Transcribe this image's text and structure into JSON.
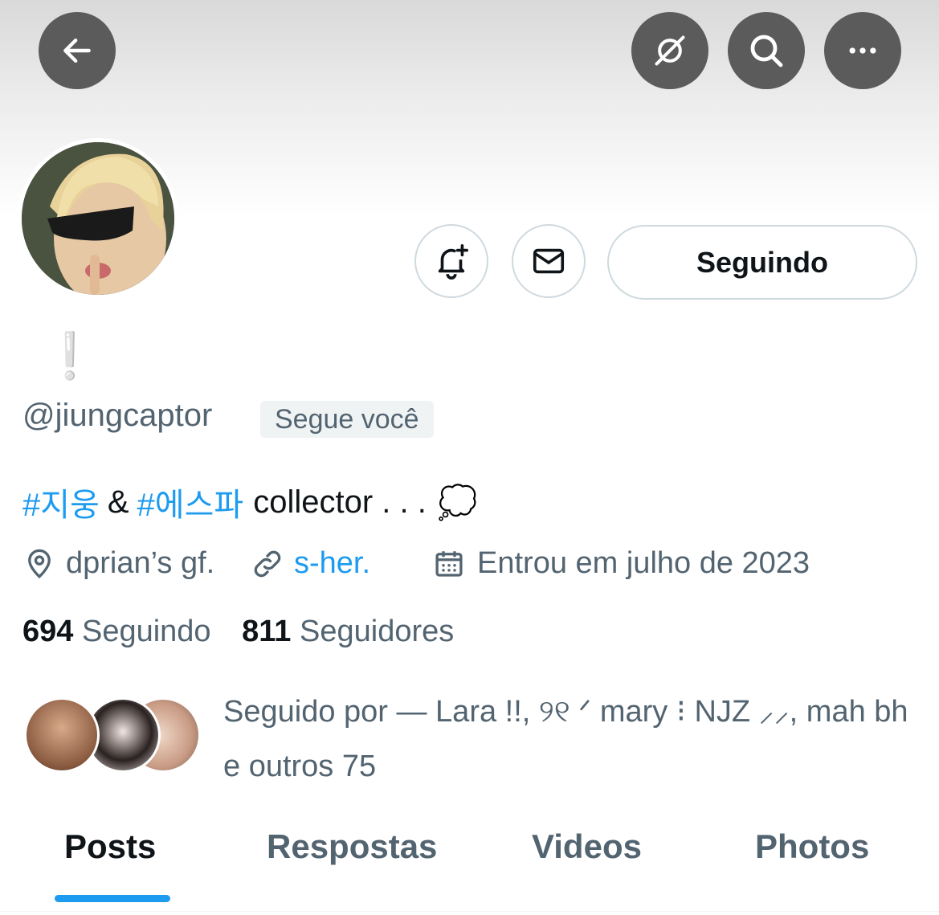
{
  "topbar": {
    "back_icon": "arrow-left-icon",
    "grok_icon": "grok-slash-circle-icon",
    "search_icon": "search-icon",
    "more_icon": "more-dots-icon"
  },
  "profile": {
    "display_name": "❕",
    "handle": "@jiungcaptor",
    "follows_you_badge": "Segue você",
    "bio": {
      "hashtag_1": "#지웅",
      "connector": "&",
      "hashtag_2": "#에스파",
      "text": "collector . . .",
      "emoji": "💭"
    },
    "location": "dprian’s gf.",
    "website": "s-her.",
    "joined": "Entrou em julho de 2023"
  },
  "actions": {
    "notify_icon": "bell-plus-icon",
    "message_icon": "mail-icon",
    "follow_label": "Seguindo"
  },
  "stats": {
    "following_count": "694",
    "following_label": "Seguindo",
    "followers_count": "811",
    "followers_label": "Seguidores"
  },
  "followed_by": {
    "line1": "Seguido por — Lara !!, ୨୧ ᐟ mary ⁝ NJZ ⸝⸝, mah bh",
    "line2": "e outros 75"
  },
  "tabs": [
    {
      "label": "Posts",
      "active": true
    },
    {
      "label": "Respostas",
      "active": false
    },
    {
      "label": "Videos",
      "active": false
    },
    {
      "label": "Photos",
      "active": false
    }
  ],
  "colors": {
    "accent": "#1d9bf0",
    "text_primary": "#0f1419",
    "text_secondary": "#536471",
    "border": "#cfd9de"
  }
}
